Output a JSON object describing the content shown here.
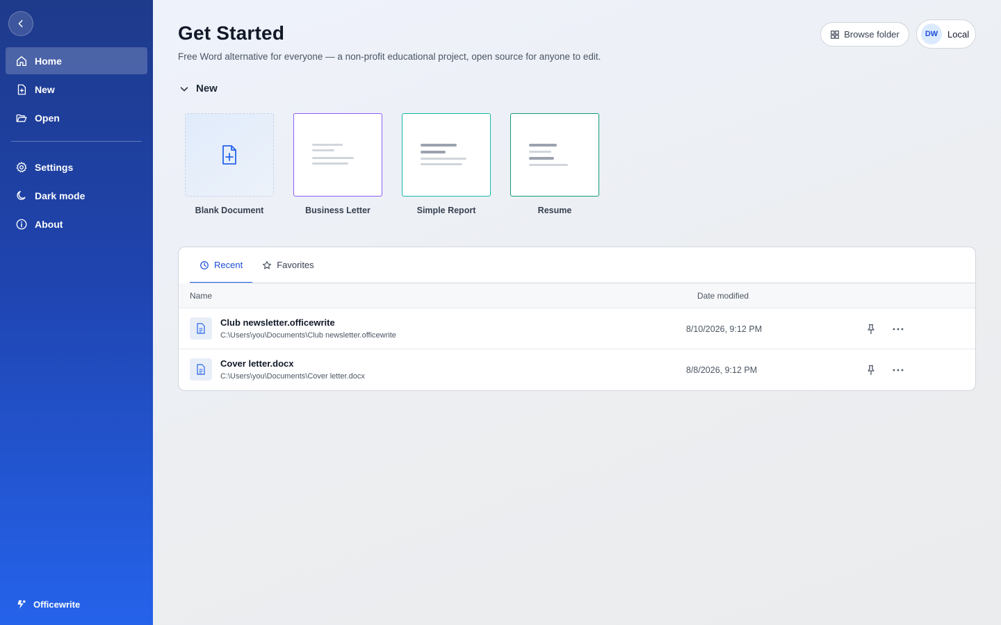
{
  "sidebar": {
    "items": [
      {
        "label": "Home",
        "icon": "home-icon",
        "active": true
      },
      {
        "label": "New",
        "icon": "new-file-icon"
      },
      {
        "label": "Open",
        "icon": "folder-open-icon"
      }
    ],
    "secondary": [
      {
        "label": "Settings",
        "icon": "gear-icon"
      },
      {
        "label": "Dark mode",
        "icon": "moon-icon"
      },
      {
        "label": "About",
        "icon": "info-icon"
      }
    ],
    "brand": "Officewrite"
  },
  "header": {
    "title": "Get Started",
    "subtitle": "Free Word alternative for everyone — a non-profit educational project, open source for anyone to edit.",
    "browse_label": "Browse folder",
    "avatar_initials": "DW",
    "account_label": "Local"
  },
  "new_section": {
    "label": "New",
    "templates": [
      {
        "label": "Blank Document"
      },
      {
        "label": "Business Letter"
      },
      {
        "label": "Simple Report"
      },
      {
        "label": "Resume"
      }
    ]
  },
  "files": {
    "tabs": [
      {
        "label": "Recent",
        "active": true
      },
      {
        "label": "Favorites"
      }
    ],
    "columns": {
      "name": "Name",
      "date": "Date modified"
    },
    "rows": [
      {
        "name": "Club newsletter.officewrite",
        "path": "C:\\Users\\you\\Documents\\Club newsletter.officewrite",
        "date": "8/10/2026, 9:12 PM"
      },
      {
        "name": "Cover letter.docx",
        "path": "C:\\Users\\you\\Documents\\Cover letter.docx",
        "date": "8/8/2026, 9:12 PM"
      }
    ]
  },
  "colors": {
    "accent": "#2563eb",
    "sidebar_top": "#1e3a8a",
    "sidebar_bottom": "#2563eb",
    "letter_border": "#8b5cf6",
    "report_border": "#14b8a6",
    "resume_border": "#0f9b77"
  }
}
